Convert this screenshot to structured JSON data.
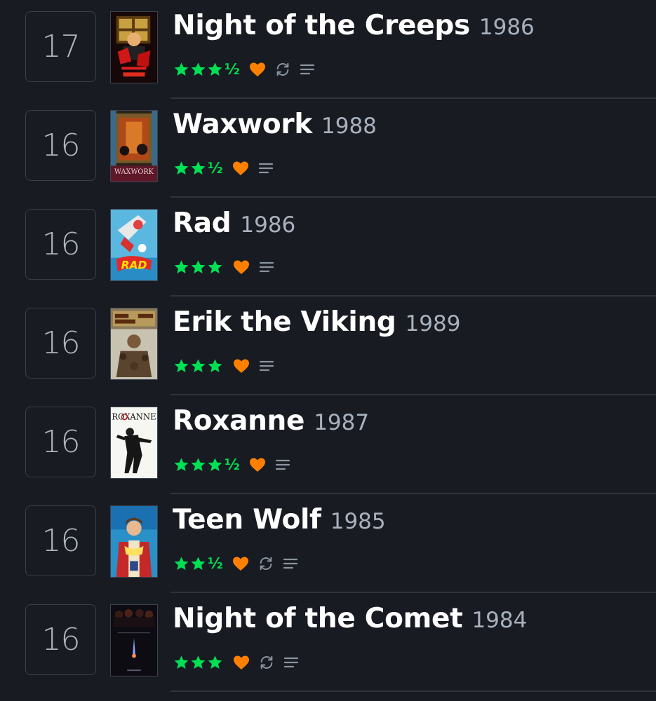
{
  "colors": {
    "background": "#181b21",
    "star": "#00e054",
    "heart": "#ff8000",
    "year": "#a8b1bd",
    "icon": "#8a94a0"
  },
  "films": [
    {
      "rank": "17",
      "title": "Night of the Creeps",
      "year": "1986",
      "full_stars": 3,
      "half_star": "½",
      "liked": true,
      "rewatch": true,
      "review": true,
      "poster": "night-of-the-creeps-poster"
    },
    {
      "rank": "16",
      "title": "Waxwork",
      "year": "1988",
      "full_stars": 2,
      "half_star": "½",
      "liked": true,
      "rewatch": false,
      "review": true,
      "poster": "waxwork-poster"
    },
    {
      "rank": "16",
      "title": "Rad",
      "year": "1986",
      "full_stars": 3,
      "half_star": "",
      "liked": true,
      "rewatch": false,
      "review": true,
      "poster": "rad-poster"
    },
    {
      "rank": "16",
      "title": "Erik the Viking",
      "year": "1989",
      "full_stars": 3,
      "half_star": "",
      "liked": true,
      "rewatch": false,
      "review": true,
      "poster": "erik-the-viking-poster"
    },
    {
      "rank": "16",
      "title": "Roxanne",
      "year": "1987",
      "full_stars": 3,
      "half_star": "½",
      "liked": true,
      "rewatch": false,
      "review": true,
      "poster": "roxanne-poster"
    },
    {
      "rank": "16",
      "title": "Teen Wolf",
      "year": "1985",
      "full_stars": 2,
      "half_star": "½",
      "liked": true,
      "rewatch": true,
      "review": true,
      "poster": "teen-wolf-poster"
    },
    {
      "rank": "16",
      "title": "Night of the Comet",
      "year": "1984",
      "full_stars": 3,
      "half_star": "",
      "liked": true,
      "rewatch": true,
      "review": true,
      "poster": "night-of-the-comet-poster"
    }
  ]
}
